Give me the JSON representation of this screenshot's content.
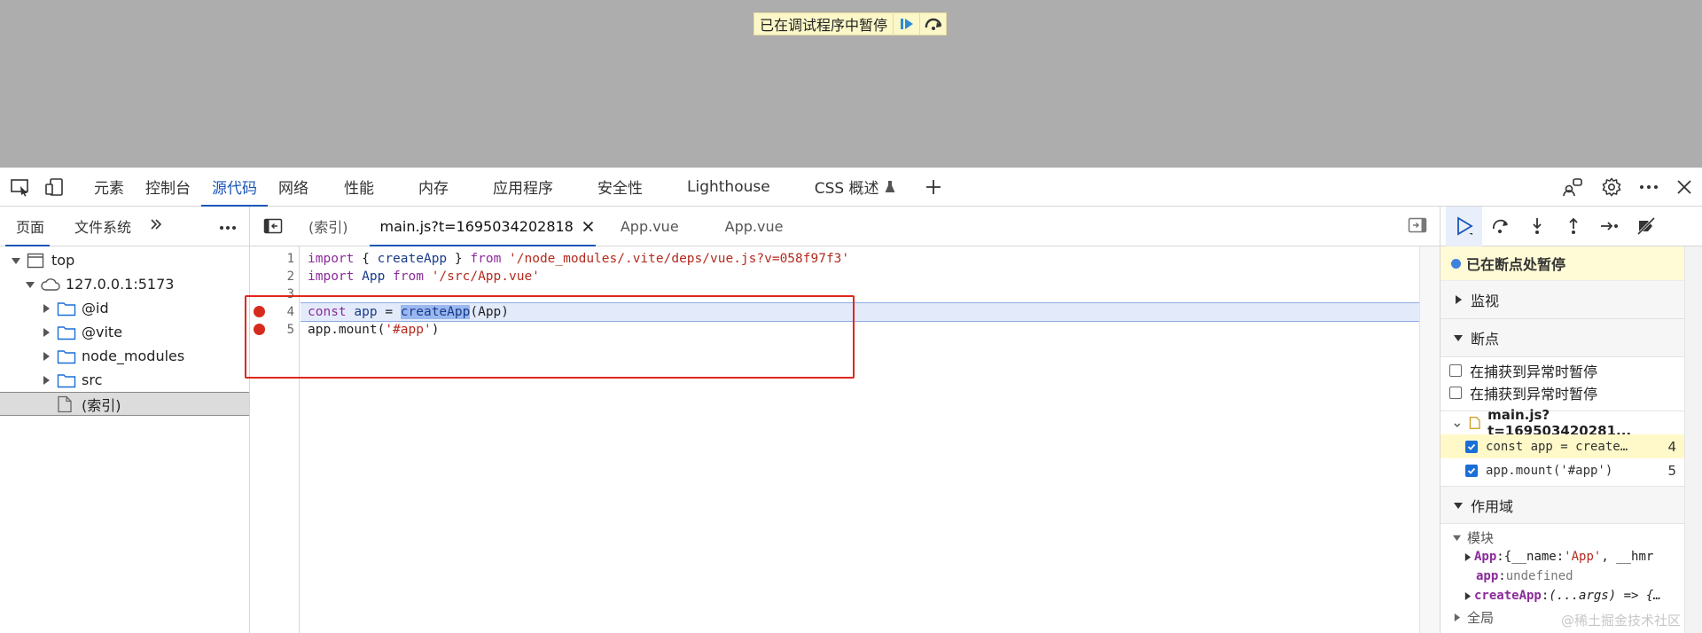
{
  "banner": {
    "text": "已在调试程序中暂停"
  },
  "devtools_tabs": [
    "元素",
    "控制台",
    "源代码",
    "网络",
    "性能",
    "内存",
    "应用程序",
    "安全性",
    "Lighthouse",
    "CSS 概述"
  ],
  "active_tab": "源代码",
  "navigator": {
    "tabs": [
      "页面",
      "文件系统"
    ],
    "tree": [
      {
        "label": "top",
        "depth": 0,
        "icon": "frame-icon",
        "expanded": true
      },
      {
        "label": "127.0.0.1:5173",
        "depth": 1,
        "icon": "cloud-icon",
        "expanded": true
      },
      {
        "label": "@id",
        "depth": 2,
        "icon": "folder-icon",
        "expanded": false
      },
      {
        "label": "@vite",
        "depth": 2,
        "icon": "folder-icon",
        "expanded": false
      },
      {
        "label": "node_modules",
        "depth": 2,
        "icon": "folder-icon",
        "expanded": false
      },
      {
        "label": "src",
        "depth": 2,
        "icon": "folder-icon",
        "expanded": false
      },
      {
        "label": "(索引)",
        "depth": 3,
        "icon": "file-icon",
        "selected": true
      }
    ]
  },
  "editor": {
    "tabs": [
      {
        "label": "(索引)",
        "active": false
      },
      {
        "label": "main.js?t=1695034202818",
        "active": true,
        "closable": true
      },
      {
        "label": "App.vue",
        "active": false
      },
      {
        "label": "App.vue",
        "active": false
      }
    ],
    "lines": [
      "1",
      "2",
      "3",
      "4",
      "5"
    ],
    "code": {
      "l1_import": "import",
      "l1_brace_open": " { ",
      "l1_name": "createApp",
      "l1_brace_close": " } ",
      "l1_from": "from",
      "l1_path": " '/node_modules/.vite/deps/vue.js?v=058f97f3'",
      "l2_import": "import",
      "l2_name": " App ",
      "l2_from": "from",
      "l2_path": " '/src/App.vue'",
      "l4_const": "const",
      "l4_app": " app ",
      "l4_eq": "= ",
      "l4_call": "createApp",
      "l4_args": "(App)",
      "l5_pre": "app.mount(",
      "l5_str": "'#app'",
      "l5_post": ")"
    }
  },
  "debugger": {
    "paused_text": "已在断点处暂停",
    "watch_label": "监视",
    "breakpoints_label": "断点",
    "checks": [
      "在捕获到异常时暂停",
      "在捕获到异常时暂停"
    ],
    "bp_file": "main.js?t=169503420281...",
    "bp_items": [
      {
        "code": "const app = create…",
        "line": "4",
        "current": true
      },
      {
        "code": "app.mount('#app')",
        "line": "5",
        "current": false
      }
    ],
    "scope_label": "作用域",
    "module_label": "模块",
    "scope_rows": [
      {
        "key": "App",
        "sep": ": ",
        "val_prefix": "{__name: ",
        "val_str": "'App'",
        "val_suffix": ", __hmr"
      },
      {
        "key": "app",
        "sep": ": ",
        "val_und": "undefined"
      },
      {
        "key": "createApp",
        "sep": ": ",
        "val_plain": "(...args) => {…"
      }
    ],
    "global_label": "全局",
    "watermark": "@稀土掘金技术社区"
  }
}
